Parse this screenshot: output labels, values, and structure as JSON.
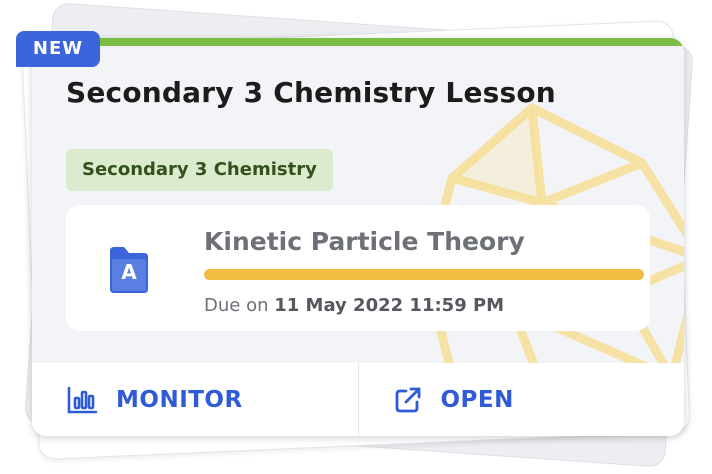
{
  "badge": {
    "label": "NEW"
  },
  "card": {
    "title": "Secondary 3 Chemistry Lesson",
    "tag": "Secondary 3 Chemistry",
    "accent_color": "#7cbd45"
  },
  "assignment": {
    "icon": "folder-a-icon",
    "icon_letter": "A",
    "title": "Kinetic Particle Theory",
    "progress_percent": 100,
    "progress_color": "#f0bd41",
    "due_prefix": "Due on",
    "due_date": "11 May 2022 11:59 PM"
  },
  "actions": {
    "monitor": {
      "label": "MONITOR",
      "icon": "bar-chart-icon"
    },
    "open": {
      "label": "OPEN",
      "icon": "external-link-icon"
    }
  }
}
